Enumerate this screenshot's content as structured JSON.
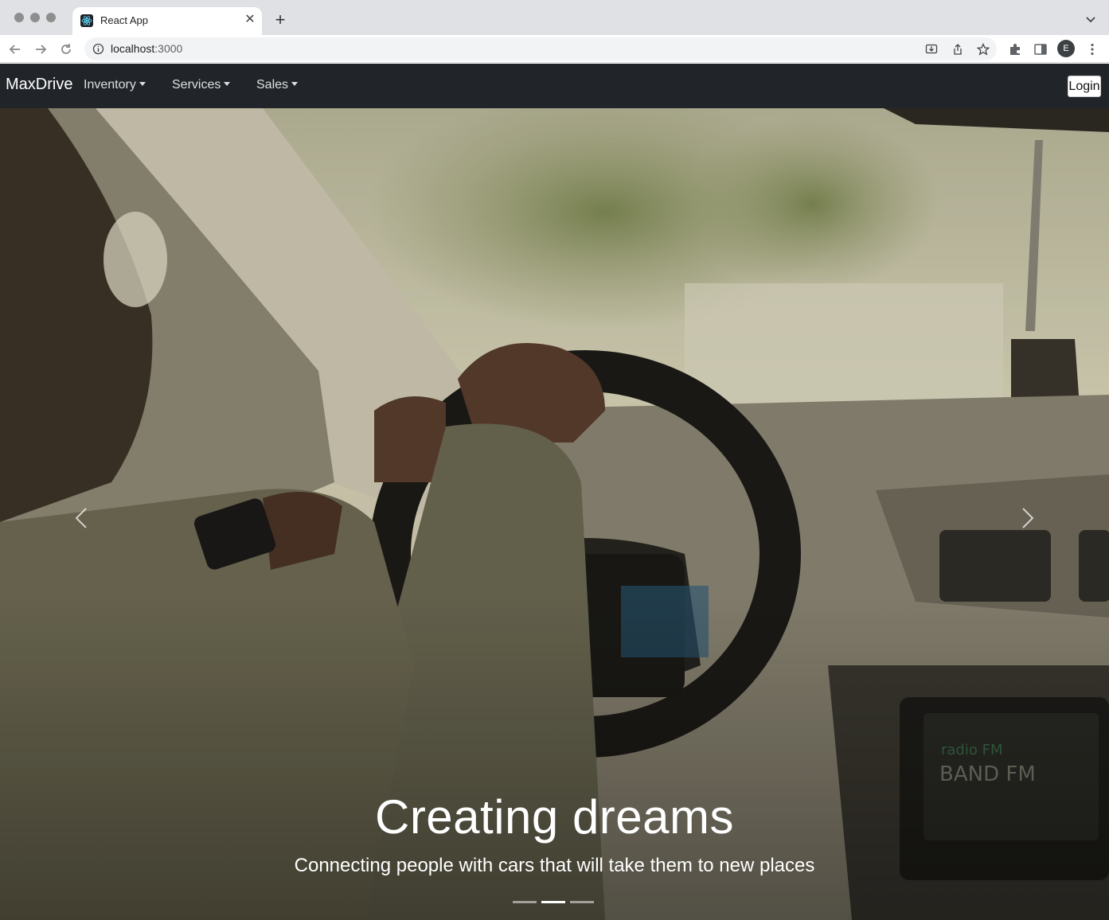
{
  "browser": {
    "tab_title": "React App",
    "url_host": "localhost",
    "url_port": ":3000",
    "profile_initial": "E"
  },
  "navbar": {
    "brand": "MaxDrive",
    "items": [
      {
        "label": "Inventory"
      },
      {
        "label": "Services"
      },
      {
        "label": "Sales"
      }
    ],
    "login_label": "Login"
  },
  "carousel": {
    "caption_title": "Creating dreams",
    "caption_text": "Connecting people with cars that will take them to new places",
    "slide_count": 3,
    "active_index": 1
  },
  "colors": {
    "navbar_bg": "#212529",
    "tabstrip_bg": "#dfe1e5"
  }
}
